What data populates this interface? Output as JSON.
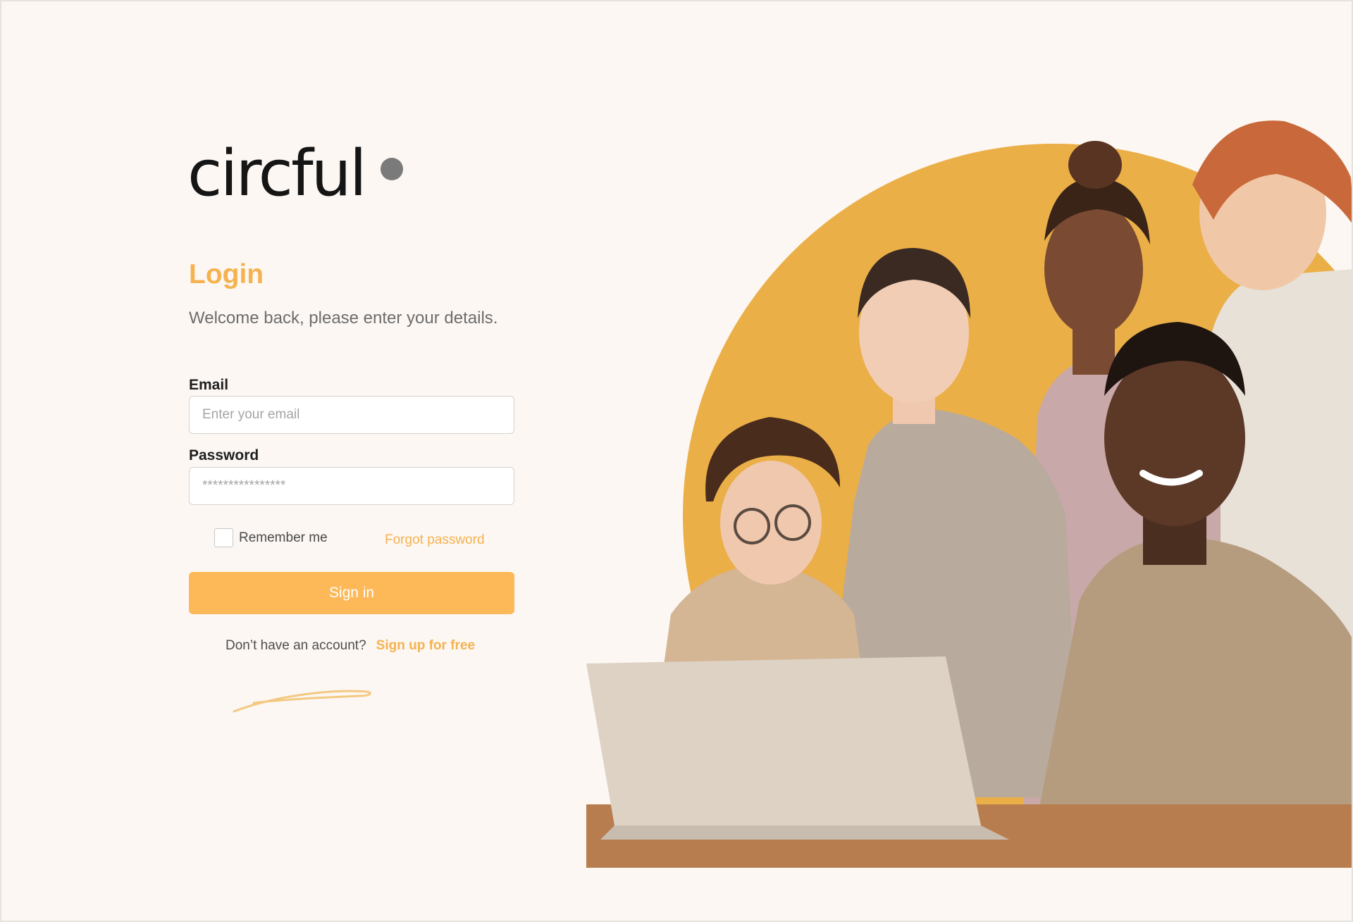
{
  "brand": {
    "name": "circful"
  },
  "login": {
    "title": "Login",
    "subtitle": "Welcome back, please enter your details.",
    "email_label": "Email",
    "email_placeholder": "Enter your email",
    "password_label": "Password",
    "password_placeholder": "****************",
    "remember_label": "Remember me",
    "remember_checked": false,
    "forgot_label": "Forgot password",
    "signin_label": "Sign in",
    "no_account_text": "Don’t have an account?",
    "signup_label": "Sign up for free"
  },
  "colors": {
    "accent": "#f5b24f",
    "button": "#fdb958",
    "background": "#fcf7f3",
    "circle": "#ebaf48",
    "logo_dot": "#7a7a7a"
  },
  "illustration": {
    "icon": "team-at-laptop-photo"
  }
}
